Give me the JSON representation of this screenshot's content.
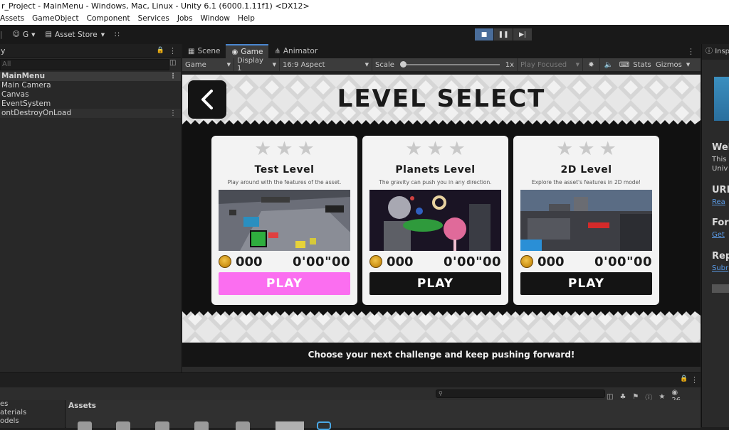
{
  "window": {
    "title": "r_Project - MainMenu - Windows, Mac, Linux - Unity 6.1 (6000.1.11f1) <DX12>"
  },
  "menubar": [
    "Assets",
    "GameObject",
    "Component",
    "Services",
    "Jobs",
    "Window",
    "Help"
  ],
  "toolbar": {
    "account": "G",
    "asset_store": "Asset Store"
  },
  "hierarchy": {
    "tab": "y",
    "search_placeholder": "All",
    "scene": "MainMenu",
    "items": [
      "Main Camera",
      "Canvas",
      "EventSystem"
    ],
    "ddol": "ontDestroyOnLoad"
  },
  "view_tabs": [
    "Scene",
    "Game",
    "Animator"
  ],
  "game_bar": {
    "mode": "Game",
    "display": "Display 1",
    "aspect": "16:9 Aspect",
    "scale_label": "Scale",
    "scale_value": "1x",
    "play_focused": "Play Focused",
    "stats": "Stats",
    "gizmos": "Gizmos"
  },
  "game": {
    "title": "LEVEL SELECT",
    "footer": "Choose your next challenge and keep pushing forward!",
    "levels": [
      {
        "name": "Test Level",
        "desc": "Play around with the features of the asset.",
        "coins": "000",
        "time": "0'00\"00",
        "play": "PLAY",
        "highlight": true
      },
      {
        "name": "Planets Level",
        "desc": "The gravity can push you in any direction.",
        "coins": "000",
        "time": "0'00\"00",
        "play": "PLAY",
        "highlight": false
      },
      {
        "name": "2D Level",
        "desc": "Explore the asset's features in 2D mode!",
        "coins": "000",
        "time": "0'00\"00",
        "play": "PLAY",
        "highlight": false
      }
    ]
  },
  "inspector": {
    "tab": "Insp",
    "welcome": "Wel",
    "welcome_t1": "This",
    "welcome_t2": "Univ",
    "urp": "URP",
    "urp_link": "Rea",
    "forum": "Foru",
    "forum_link": "Get",
    "report": "Rep",
    "report_link": "Subr"
  },
  "project": {
    "folders": [
      "es",
      "aterials",
      "odels"
    ],
    "assets_label": "Assets",
    "count": "26"
  },
  "colors": {
    "accent_pink": "#fb6ef0",
    "tab_active": "#4a87d0"
  }
}
